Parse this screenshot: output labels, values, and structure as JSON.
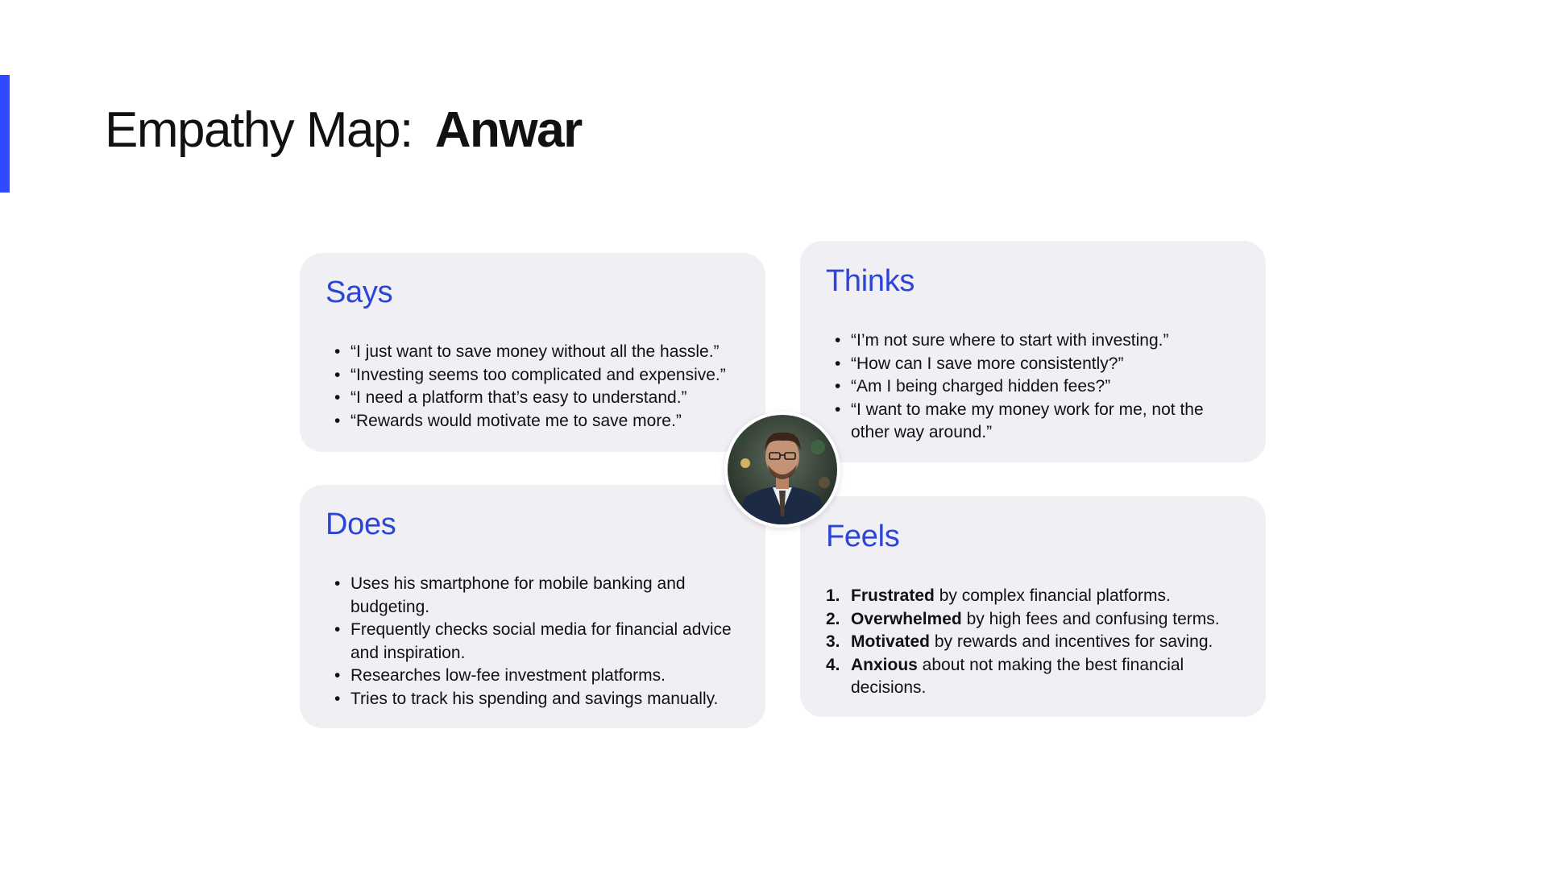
{
  "page": {
    "title_prefix": "Empathy Map:",
    "title_name": "Anwar",
    "accent_color": "#2f4bff",
    "heading_color": "#2d44d6",
    "card_background": "#f0eff4"
  },
  "avatar": {
    "icon": "person-portrait-icon"
  },
  "says": {
    "title": "Says",
    "items": [
      "“I just want to save money without all the hassle.”",
      "“Investing seems too complicated and expensive.”",
      "“I need a platform that’s easy to understand.”",
      "“Rewards would motivate me to save more.”"
    ]
  },
  "thinks": {
    "title": "Thinks",
    "items": [
      "“I’m not sure where to start with investing.”",
      "“How can I save more consistently?”",
      "“Am I being charged hidden fees?”",
      "“I want to make my money work for me, not the other way around.”"
    ]
  },
  "does": {
    "title": "Does",
    "items": [
      "Uses his smartphone for mobile banking and budgeting.",
      "Frequently checks social media for financial advice and inspiration.",
      "Researches low-fee investment platforms.",
      "Tries to track his spending and savings manually."
    ]
  },
  "feels": {
    "title": "Feels",
    "items": [
      {
        "number": "1.",
        "strong": "Frustrated",
        "rest": " by complex financial platforms."
      },
      {
        "number": "2.",
        "strong": "Overwhelmed",
        "rest": " by high fees and confusing terms."
      },
      {
        "number": "3.",
        "strong": "Motivated",
        "rest": " by rewards and incentives for saving."
      },
      {
        "number": "4.",
        "strong": "Anxious",
        "rest": " about not making the best financial decisions."
      }
    ]
  }
}
